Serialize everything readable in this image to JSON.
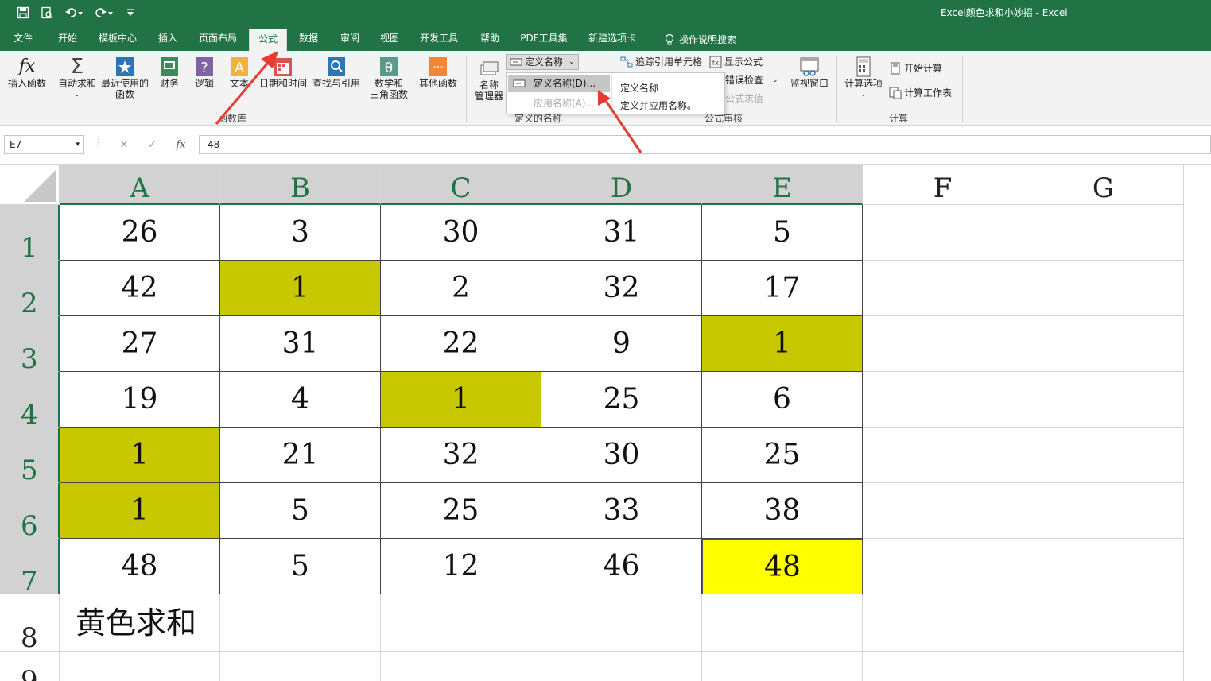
{
  "window": {
    "title": "Excel颜色求和小妙招  -  Excel"
  },
  "quick_access": [
    {
      "name": "save-icon",
      "glyph": "🖫"
    },
    {
      "name": "print-preview-icon",
      "glyph": "🔍"
    },
    {
      "name": "undo-icon",
      "glyph": "↶"
    },
    {
      "name": "redo-icon",
      "glyph": "↷"
    },
    {
      "name": "customize-icon",
      "glyph": "⇊"
    }
  ],
  "menu": {
    "tabs": [
      "文件",
      "开始",
      "模板中心",
      "插入",
      "页面布局",
      "公式",
      "数据",
      "审阅",
      "视图",
      "开发工具",
      "帮助",
      "PDF工具集",
      "新建选项卡"
    ],
    "active": "公式",
    "tell_me": "操作说明搜索"
  },
  "ribbon": {
    "function_library": {
      "label": "函数库",
      "buttons": [
        "插入函数",
        "自动求和",
        "最近使用的\n函数",
        "财务",
        "逻辑",
        "文本",
        "日期和时间",
        "查找与引用",
        "数学和\n三角函数",
        "其他函数"
      ]
    },
    "defined_names": {
      "label": "定义的名称",
      "name_manager": "名称\n管理器",
      "define_name": "定义名称"
    },
    "formula_auditing": {
      "label": "公式审核",
      "trace_precedents": "追踪引用单元格",
      "show_formulas": "显示公式",
      "error_checking": "错误检查",
      "evaluate_formula": "公式求值",
      "watch_window": "监视窗口"
    },
    "calculation": {
      "label": "计算",
      "calc_options": "计算选项",
      "calc_now": "开始计算",
      "calc_sheet": "计算工作表"
    }
  },
  "dropdown": {
    "item1": "定义名称(D)...",
    "item2": "应用名称(A)...",
    "tip_title": "定义名称",
    "tip_desc": "定义并应用名称。"
  },
  "formula_bar": {
    "name_box": "E7",
    "cancel": "✕",
    "enter": "✓",
    "fx": "fx",
    "value": "48"
  },
  "sheet": {
    "columns": [
      "A",
      "B",
      "C",
      "D",
      "E",
      "F",
      "G"
    ],
    "selected_column": "E",
    "rows": [
      [
        "26",
        "3",
        "30",
        "31",
        "5"
      ],
      [
        "42",
        "1",
        "2",
        "32",
        "17"
      ],
      [
        "27",
        "31",
        "22",
        "9",
        "1"
      ],
      [
        "19",
        "4",
        "1",
        "25",
        "6"
      ],
      [
        "1",
        "21",
        "32",
        "30",
        "25"
      ],
      [
        "1",
        "5",
        "25",
        "33",
        "38"
      ],
      [
        "48",
        "5",
        "12",
        "46",
        "48"
      ]
    ],
    "row8_label": "黄色求和",
    "row_numbers": [
      "1",
      "2",
      "3",
      "4",
      "5",
      "6",
      "7",
      "8",
      "9"
    ],
    "fill_colors": {
      "olive": "#c8c800",
      "yellow": "#ffff00"
    }
  },
  "colors": {
    "excel_green": "#217346",
    "arrow_red": "#e83a2f"
  }
}
